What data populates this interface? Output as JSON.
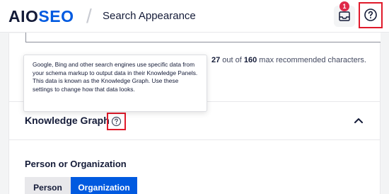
{
  "header": {
    "logo_aio": "AIO",
    "logo_seo": "SE",
    "logo_o": "O",
    "divider": "/",
    "title": "Search Appearance",
    "notification_count": "1",
    "notification_icon": "inbox-icon",
    "help_icon": "help-circle-icon"
  },
  "description_card": {
    "count_current": "27",
    "count_middle": " out of ",
    "count_max": "160",
    "count_suffix": " max recommended characters."
  },
  "tooltip": {
    "text": "Google, Bing and other search engines use specific data from your schema markup to output data in their Knowledge Panels. This data is known as the Knowledge Graph. Use these settings to change how that data looks."
  },
  "knowledge_graph": {
    "title": "Knowledge Graph",
    "help_icon": "help-circle-icon",
    "collapse_icon": "chevron-up-icon",
    "person_or_org_label": "Person or Organization",
    "options": [
      "Person",
      "Organization"
    ],
    "selected": "Organization"
  },
  "colors": {
    "brand_blue": "#005ae0",
    "badge_red": "#df2a4a",
    "highlight_red": "#e01a2b",
    "text_dark": "#141b38"
  }
}
